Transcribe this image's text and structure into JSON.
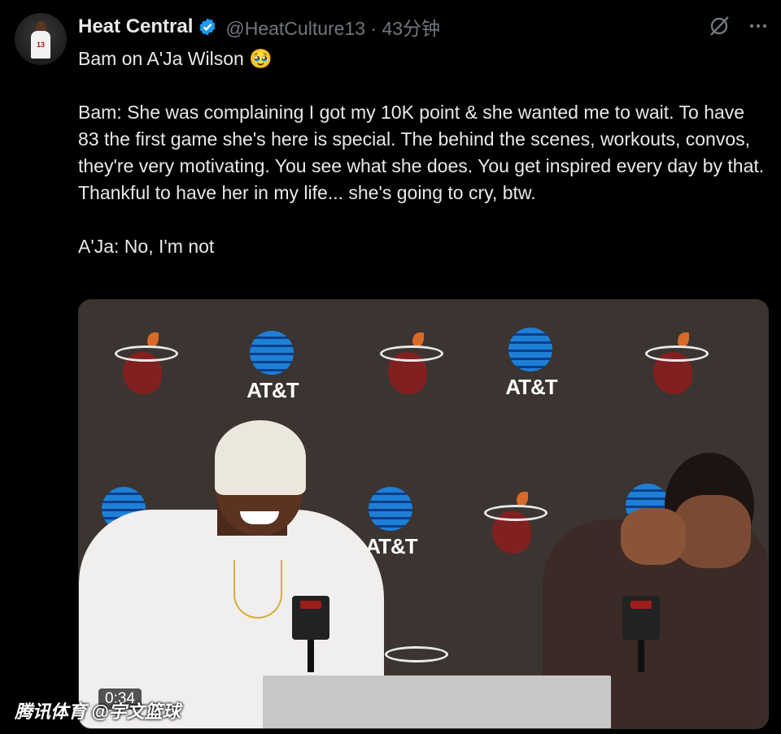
{
  "tweet": {
    "display_name": "Heat Central",
    "handle_time": "@HeatCulture13 · 43分钟",
    "text": "Bam on A'Ja Wilson 🥹\n\nBam: She was complaining I got my 10K point & she wanted me to wait. To have 83 the first game she's here is special. The behind the scenes, workouts, convos, they're very motivating. You see what she does. You get inspired every day by that. Thankful to have her in my life... she's going to cry, btw.\n\nA'Ja: No, I'm not",
    "avatar_number": "13"
  },
  "media": {
    "timestamp": "0:34",
    "sponsor_label": "AT&T"
  },
  "watermark": "腾讯体育 @宇文篮球",
  "icons": {
    "verified": "verified-badge-icon",
    "grok": "grok-icon",
    "more": "more-icon"
  },
  "colors": {
    "background": "#000000",
    "verified_blue": "#1d9bf0",
    "secondary_text": "#71767b",
    "heat_red": "#98002e"
  }
}
